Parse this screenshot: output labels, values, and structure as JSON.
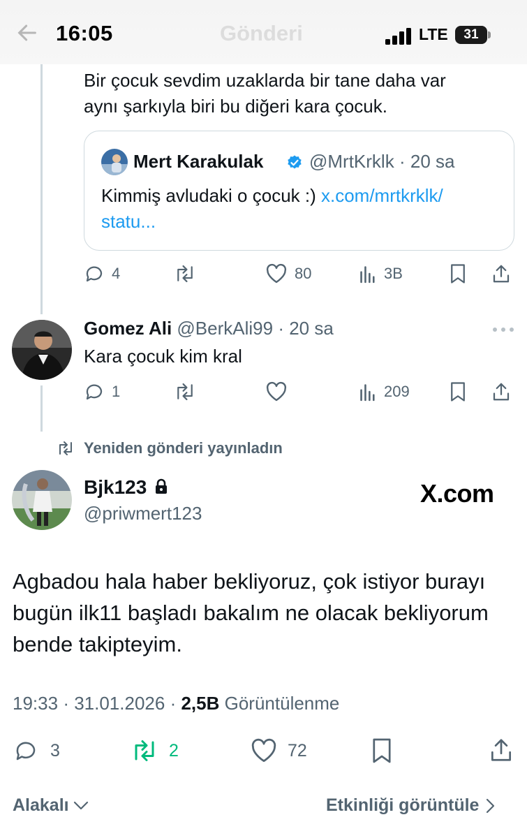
{
  "status": {
    "time": "16:05",
    "network": "LTE",
    "battery": "31",
    "header_title": "Gönderi"
  },
  "post1": {
    "text_line1": "Bir çocuk sevdim uzaklarda bir tane daha var",
    "text_line2": "aynı şarkıyla biri bu diğeri kara çocuk.",
    "quote": {
      "name": "Mert Karakulak",
      "handle": "@MrtKrklk",
      "sep": "·",
      "time": "20 sa",
      "text": "Kimmiş avludaki o çocuk :) ",
      "link_line1": "x.com/mrtkrklk/",
      "link_line2": "statu..."
    },
    "actions": {
      "replies": "4",
      "likes": "80",
      "views": "3B"
    }
  },
  "post2": {
    "name": "Gomez Ali",
    "handle": "@BerkAli99",
    "sep": "·",
    "time": "20 sa",
    "text": "Kara çocuk kim kral",
    "actions": {
      "replies": "1",
      "views": "209"
    }
  },
  "repost_context": "Yeniden gönderi yayınladın",
  "main": {
    "name": "Bjk123",
    "handle": "@priwmert123",
    "watermark": "X.com",
    "text_line1": "Agbadou hala haber bekliyoruz, çok istiyor burayı",
    "text_line2": "bugün ilk11 başladı bakalım ne olacak bekliyorum",
    "text_line3": "bende takipteyim.",
    "time": "19:33",
    "date": "31.01.2026",
    "views_count": "2,5B",
    "views_label": "Görüntülenme",
    "actions": {
      "replies": "3",
      "reposts": "2",
      "likes": "72"
    }
  },
  "footer": {
    "sort_label": "Alakalı",
    "activity_label": "Etkinliği görüntüle"
  },
  "colors": {
    "accent": "#1d9bf0",
    "repost_green": "#00ba7c",
    "muted": "#536471"
  }
}
